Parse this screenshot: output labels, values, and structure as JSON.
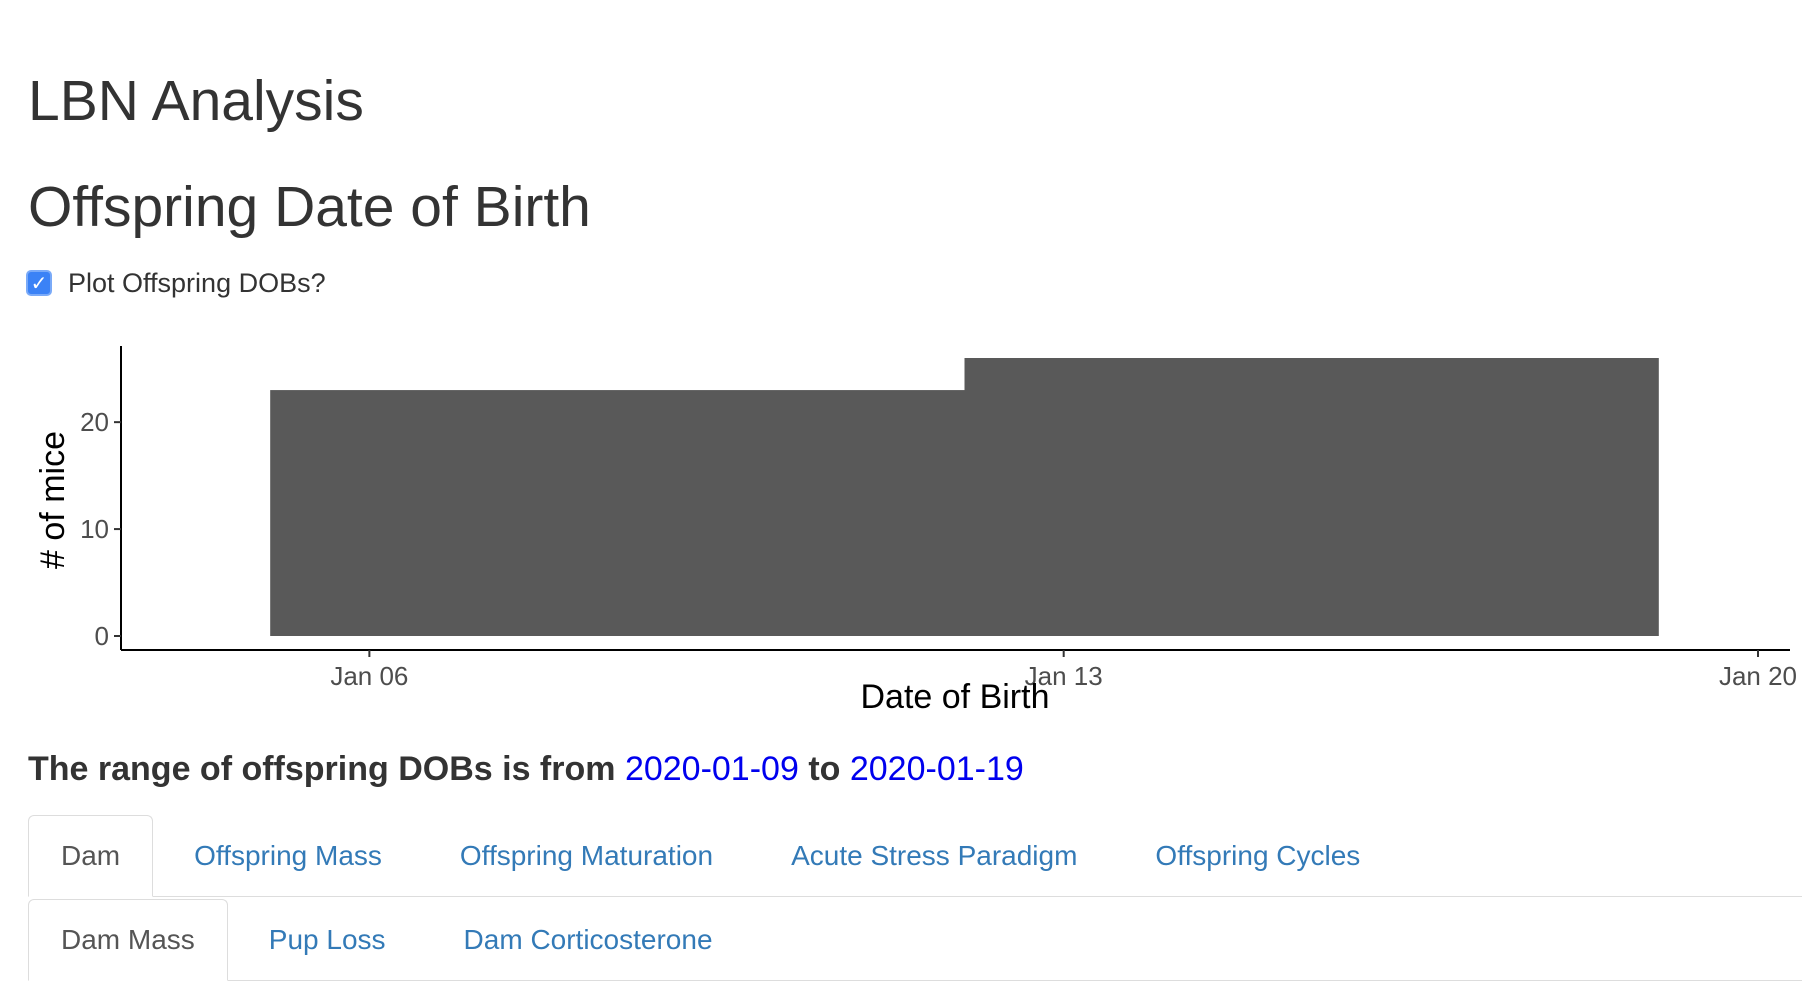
{
  "header": {
    "title": "LBN Analysis",
    "subtitle": "Offspring Date of Birth"
  },
  "options": {
    "plot_dobs_label": "Plot Offspring DOBs?",
    "plot_dobs_checked": true
  },
  "chart_data": {
    "type": "bar",
    "bars": [
      {
        "start": "2020-01-05",
        "end": "2020-01-12",
        "value": 23
      },
      {
        "start": "2020-01-12",
        "end": "2020-01-19",
        "value": 26
      }
    ],
    "xlabel": "Date of Birth",
    "ylabel": "# of mice",
    "x_ticks": [
      {
        "date": "2020-01-06",
        "label": "Jan 06"
      },
      {
        "date": "2020-01-13",
        "label": "Jan 13"
      },
      {
        "date": "2020-01-20",
        "label": "Jan 20"
      }
    ],
    "y_ticks": [
      0,
      10,
      20
    ],
    "xlim": [
      "2020-01-04",
      "2020-01-20"
    ],
    "ylim": [
      0,
      26
    ],
    "grid": false,
    "bar_color": "#595959"
  },
  "summary": {
    "prefix": "The range of offspring DOBs is from",
    "from": "2020-01-09",
    "joiner": "to",
    "to": "2020-01-19"
  },
  "tabs_primary": [
    "Dam",
    "Offspring Mass",
    "Offspring Maturation",
    "Acute Stress Paradigm",
    "Offspring Cycles"
  ],
  "tabs_secondary": [
    "Dam Mass",
    "Pup Loss",
    "Dam Corticosterone"
  ],
  "colors": {
    "link": "#337ab7",
    "date_highlight": "#0000ee",
    "checkbox": "#3b82f6"
  }
}
